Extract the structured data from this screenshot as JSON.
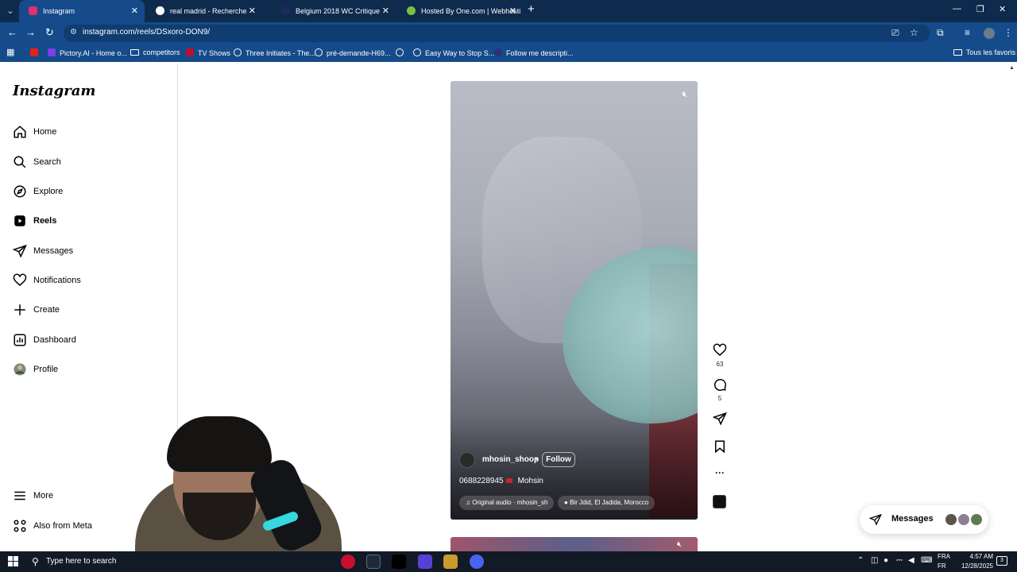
{
  "browser": {
    "tabs": [
      {
        "title": "Instagram",
        "color": "#e1306c",
        "active": true
      },
      {
        "title": "real madrid - Recherche Googl",
        "color": "#ffffff",
        "active": false
      },
      {
        "title": "Belgium 2018 WC Critique",
        "color": "#1a2b5b",
        "active": false
      },
      {
        "title": "Hosted By One.com | Webhosti",
        "color": "#7ac142",
        "active": false
      }
    ],
    "url": "instagram.com/reels/DSxoro-DON9/",
    "bookmarks": [
      {
        "label": "",
        "icon": "youtube-icon"
      },
      {
        "label": "Pictory.AI - Home o...",
        "icon": "pictory-icon"
      },
      {
        "label": "competitors",
        "icon": "folder-icon"
      },
      {
        "label": "TV Shows",
        "icon": "tv-icon"
      },
      {
        "label": "Three Initiates - The...",
        "icon": "globe-icon"
      },
      {
        "label": "pré-demande-H69...",
        "icon": "globe-icon"
      },
      {
        "label": "",
        "icon": "globe-icon"
      },
      {
        "label": "Easy Way to Stop S...",
        "icon": "globe-icon"
      },
      {
        "label": "Follow me descripti...",
        "icon": "globe-icon"
      }
    ],
    "all_bookmarks": "Tous les favoris"
  },
  "instagram": {
    "logo": "Instagram",
    "nav": [
      {
        "label": "Home",
        "icon": "home-icon"
      },
      {
        "label": "Search",
        "icon": "search-icon"
      },
      {
        "label": "Explore",
        "icon": "explore-icon"
      },
      {
        "label": "Reels",
        "icon": "reels-icon"
      },
      {
        "label": "Messages",
        "icon": "messages-icon"
      },
      {
        "label": "Notifications",
        "icon": "heart-icon"
      },
      {
        "label": "Create",
        "icon": "plus-icon"
      },
      {
        "label": "Dashboard",
        "icon": "dashboard-icon"
      },
      {
        "label": "Profile",
        "icon": "profile-avatar"
      }
    ],
    "bottom_nav": [
      {
        "label": "More",
        "icon": "menu-icon"
      },
      {
        "label": "Also from Meta",
        "icon": "meta-icon"
      }
    ],
    "reel": {
      "username": "mhosin_shoop",
      "follow": "Follow",
      "caption_number": "0688228945",
      "caption_name": "Mohsin",
      "audio_label": "Original audio",
      "audio_author": "mhosin_sh",
      "location": "Bir Jdid, El Jadida, Morocco",
      "likes": "63",
      "comments": "5"
    },
    "messages_label": "Messages"
  },
  "taskbar": {
    "search_placeholder": "Type here to search",
    "lang_1": "FRA",
    "lang_2": "FR",
    "time": "4:57 AM",
    "date": "12/28/2025",
    "notification_count": "3"
  }
}
